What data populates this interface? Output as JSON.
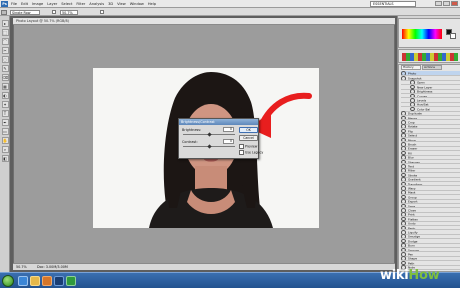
{
  "menubar": {
    "logo": "Ps",
    "items": [
      "File",
      "Edit",
      "Image",
      "Layer",
      "Select",
      "Filter",
      "Analysis",
      "3D",
      "View",
      "Window",
      "Help"
    ],
    "workspace": "ESSENTIALS"
  },
  "options": {
    "preset": "Single Row",
    "zoom": "50.7%"
  },
  "document": {
    "tab_title": "Photo Layout @ 50.7% (RGB/8)",
    "status": "50.7%",
    "status_doc": "Doc: 3.00M/3.00M"
  },
  "dialog": {
    "title": "Brightness/Contrast",
    "brightness_label": "Brightness:",
    "brightness_value": "0",
    "contrast_label": "Contrast:",
    "contrast_value": "0",
    "ok_label": "OK",
    "cancel_label": "Cancel",
    "preview_label": "Preview",
    "legacy_label": "Use Legacy"
  },
  "panel": {
    "tabs": [
      "History",
      "Actions"
    ],
    "top_row": "Photo",
    "history_rows": [
      {
        "label": "Snapshot",
        "sub": false
      },
      {
        "label": "Open",
        "sub": true
      },
      {
        "label": "New Layer",
        "sub": true
      },
      {
        "label": "Brightness",
        "sub": true
      },
      {
        "label": "Curves",
        "sub": true
      },
      {
        "label": "Levels",
        "sub": true
      },
      {
        "label": "Hue/Sat",
        "sub": true
      },
      {
        "label": "Color Bal",
        "sub": true
      },
      {
        "label": "Duplicate",
        "sub": false
      },
      {
        "label": "Merge",
        "sub": false
      },
      {
        "label": "Crop",
        "sub": false
      },
      {
        "label": "Rotate",
        "sub": false
      },
      {
        "label": "Flip",
        "sub": false
      },
      {
        "label": "Select",
        "sub": false
      },
      {
        "label": "Move",
        "sub": false
      },
      {
        "label": "Brush",
        "sub": false
      },
      {
        "label": "Eraser",
        "sub": false
      },
      {
        "label": "Fill",
        "sub": false
      },
      {
        "label": "Blur",
        "sub": false
      },
      {
        "label": "Sharpen",
        "sub": false
      },
      {
        "label": "Text",
        "sub": false
      },
      {
        "label": "Filter",
        "sub": false
      },
      {
        "label": "Stroke",
        "sub": false
      },
      {
        "label": "Gradient",
        "sub": false
      },
      {
        "label": "Transform",
        "sub": false
      },
      {
        "label": "Warp",
        "sub": false
      },
      {
        "label": "Mask",
        "sub": false
      },
      {
        "label": "Group",
        "sub": false
      },
      {
        "label": "Export",
        "sub": false
      },
      {
        "label": "Save",
        "sub": false
      },
      {
        "label": "Close",
        "sub": false
      },
      {
        "label": "Print",
        "sub": false
      },
      {
        "label": "Flatten",
        "sub": false
      },
      {
        "label": "Undo",
        "sub": false
      },
      {
        "label": "Redo",
        "sub": false
      },
      {
        "label": "Liquify",
        "sub": false
      },
      {
        "label": "Smudge",
        "sub": false
      },
      {
        "label": "Dodge",
        "sub": false
      },
      {
        "label": "Burn",
        "sub": false
      },
      {
        "label": "Sponge",
        "sub": false
      },
      {
        "label": "Pen",
        "sub": false
      },
      {
        "label": "Shape",
        "sub": false
      },
      {
        "label": "Path",
        "sub": false
      },
      {
        "label": "Note",
        "sub": false
      }
    ]
  },
  "watermark": {
    "wiki": "wiki",
    "how": "How"
  },
  "colors": {
    "arrow": "#e81e1e",
    "accent": "#2f6db3",
    "taskbar": "#2a5da0"
  }
}
